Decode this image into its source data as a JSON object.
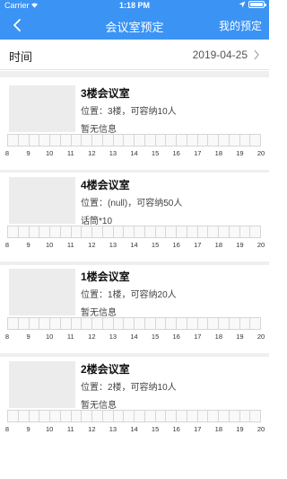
{
  "status": {
    "carrier": "Carrier",
    "time": "1:18 PM"
  },
  "nav": {
    "title": "会议室预定",
    "right_label": "我的预定"
  },
  "time_row": {
    "label": "时间",
    "date": "2019-04-25"
  },
  "hours": [
    "8",
    "9",
    "10",
    "11",
    "12",
    "13",
    "14",
    "15",
    "16",
    "17",
    "18",
    "19",
    "20"
  ],
  "rooms": [
    {
      "name": "3楼会议室",
      "location": "位置：3楼，可容纳10人",
      "info": "暂无信息"
    },
    {
      "name": "4楼会议室",
      "location": "位置：(null)，可容纳50人",
      "info": "话筒*10"
    },
    {
      "name": "1楼会议室",
      "location": "位置：1楼，可容纳20人",
      "info": "暂无信息"
    },
    {
      "name": "2楼会议室",
      "location": "位置：2楼，可容纳10人",
      "info": "暂无信息"
    }
  ],
  "colors": {
    "accent": "#3b93f4",
    "separator": "#efeff2"
  }
}
